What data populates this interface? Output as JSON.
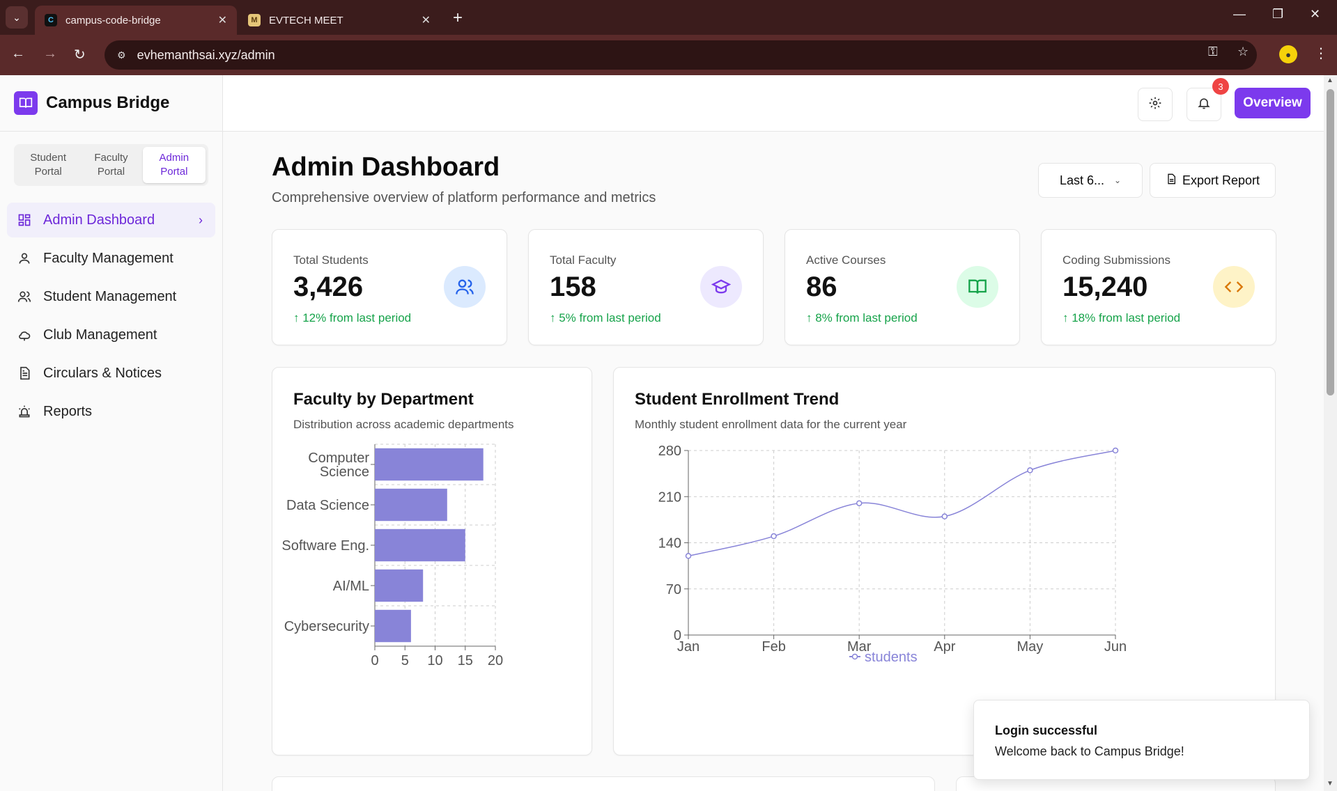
{
  "browser": {
    "tabs": [
      {
        "label": "campus-code-bridge",
        "favicon": "C"
      },
      {
        "label": "EVTECH MEET",
        "favicon": "M"
      }
    ],
    "url": "evhemanthsai.xyz/admin"
  },
  "app": {
    "brand": "Campus Bridge",
    "portals": [
      {
        "label": "Student Portal"
      },
      {
        "label": "Faculty Portal"
      },
      {
        "label": "Admin Portal",
        "active": true
      }
    ],
    "nav": [
      {
        "label": "Admin Dashboard",
        "icon": "dashboard-icon",
        "active": true
      },
      {
        "label": "Faculty Management",
        "icon": "user-icon"
      },
      {
        "label": "Student Management",
        "icon": "users-icon"
      },
      {
        "label": "Club Management",
        "icon": "cloud-icon"
      },
      {
        "label": "Circulars & Notices",
        "icon": "document-icon"
      },
      {
        "label": "Reports",
        "icon": "siren-icon"
      }
    ],
    "notification_count": "3",
    "overview_label": "Overview"
  },
  "page": {
    "title": "Admin Dashboard",
    "subtitle": "Comprehensive overview of platform performance and metrics",
    "range_label": "Last 6...",
    "export_label": "Export Report"
  },
  "stats": [
    {
      "label": "Total Students",
      "value": "3,426",
      "delta": "↑ 12% from last period",
      "icon": "users-icon",
      "color": "#2563eb",
      "bg": "#dbeafe"
    },
    {
      "label": "Total Faculty",
      "value": "158",
      "delta": "↑ 5% from last period",
      "icon": "graduation-cap-icon",
      "color": "#7c3aed",
      "bg": "#ede9fe"
    },
    {
      "label": "Active Courses",
      "value": "86",
      "delta": "↑ 8% from last period",
      "icon": "book-icon",
      "color": "#16a34a",
      "bg": "#dcfce7"
    },
    {
      "label": "Coding Submissions",
      "value": "15,240",
      "delta": "↑ 18% from last period",
      "icon": "code-icon",
      "color": "#d97706",
      "bg": "#fef3c7"
    }
  ],
  "chart_data": [
    {
      "type": "bar",
      "orientation": "horizontal",
      "title": "Faculty by Department",
      "subtitle": "Distribution across academic departments",
      "categories": [
        "Computer Science",
        "Data Science",
        "Software Eng.",
        "AI/ML",
        "Cybersecurity"
      ],
      "values": [
        18,
        12,
        15,
        8,
        6
      ],
      "xlim": [
        0,
        20
      ],
      "xticks": [
        0,
        5,
        10,
        15,
        20
      ],
      "color": "#8884d8",
      "grid": true
    },
    {
      "type": "line",
      "title": "Student Enrollment Trend",
      "subtitle": "Monthly student enrollment data for the current year",
      "categories": [
        "Jan",
        "Feb",
        "Mar",
        "Apr",
        "May",
        "Jun"
      ],
      "series": [
        {
          "name": "students",
          "values": [
            120,
            150,
            200,
            180,
            250,
            280
          ]
        }
      ],
      "ylim": [
        0,
        280
      ],
      "yticks": [
        0,
        70,
        140,
        210,
        280
      ],
      "color": "#8884d8",
      "grid": true,
      "legend": "bottom"
    }
  ],
  "toast": {
    "title": "Login successful",
    "message": "Welcome back to Campus Bridge!"
  }
}
